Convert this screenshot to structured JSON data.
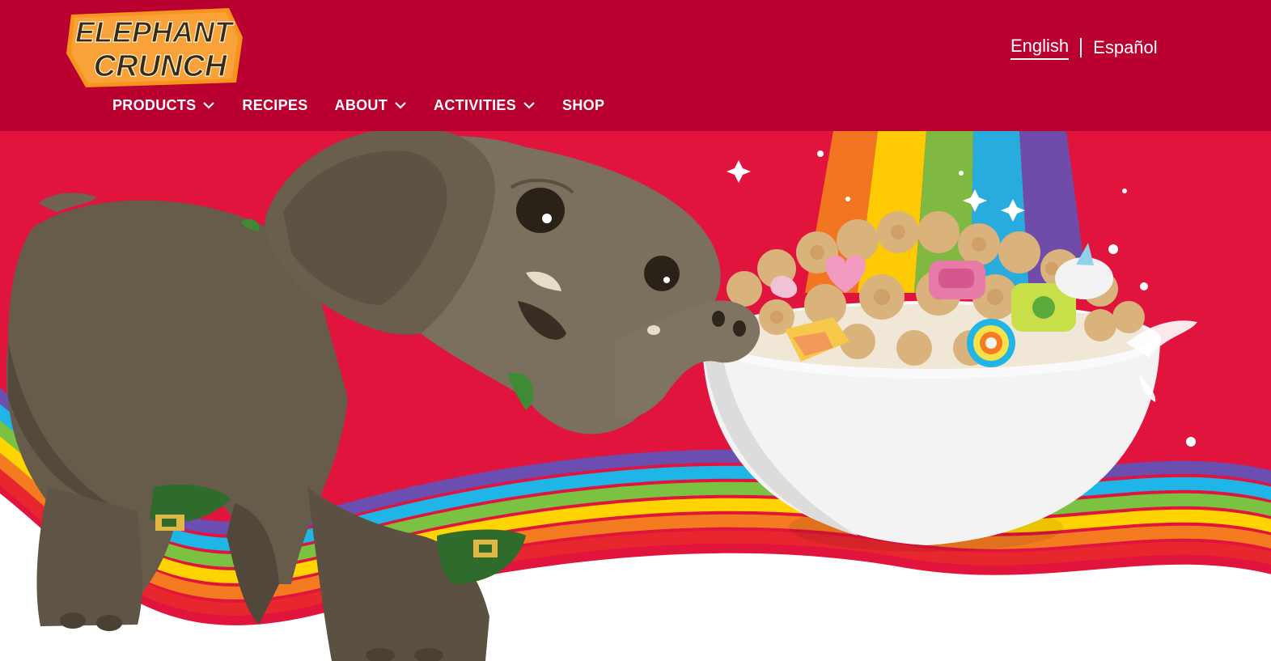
{
  "brand": {
    "logo_line1": "ELEPHANT",
    "logo_line2": "CRUNCH"
  },
  "language": {
    "options": [
      {
        "label": "English",
        "active": true
      },
      {
        "label": "Español",
        "active": false
      }
    ]
  },
  "nav": {
    "items": [
      {
        "label": "PRODUCTS",
        "has_dropdown": true,
        "icon": "chevron-down-icon"
      },
      {
        "label": "RECIPES",
        "has_dropdown": false
      },
      {
        "label": "ABOUT",
        "has_dropdown": true,
        "icon": "chevron-down-icon"
      },
      {
        "label": "ACTIVITIES",
        "has_dropdown": true,
        "icon": "chevron-down-icon"
      },
      {
        "label": "SHOP",
        "has_dropdown": false
      }
    ]
  },
  "hero": {
    "image_subjects": [
      "elephant-illustration",
      "cereal-bowl-illustration",
      "rainbow-illustration"
    ]
  },
  "colors": {
    "header_bg": "#ba0030",
    "hero_bg": "#e0143c",
    "logo_fill": "#f7941d",
    "logo_text": "#3a2a1a",
    "rainbow": [
      "#e8262e",
      "#f47b20",
      "#ffd400",
      "#7bc242",
      "#1fb5e6",
      "#6a4fb0"
    ]
  }
}
